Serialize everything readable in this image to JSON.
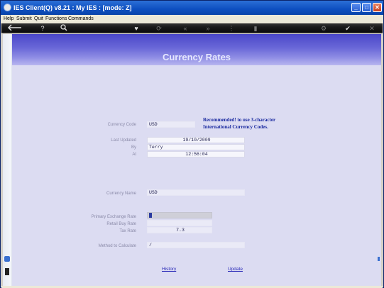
{
  "window": {
    "title": "IES Client(Q) v8.21 : My IES :       [mode: Z]",
    "minimize": "_",
    "maximize": "□",
    "close": "✕"
  },
  "menu": [
    "Help",
    "Submit",
    "Quit",
    "Functions",
    "Commands"
  ],
  "toolbar": {
    "back_icon": "arrow-left-icon",
    "help": "?",
    "search": "🔍",
    "heart": "♥",
    "refresh": "⟳",
    "prev": "«",
    "next": "»",
    "options": "⋮",
    "record": "▮",
    "settings": "⚙",
    "check": "✔",
    "close": "✕"
  },
  "page": {
    "title": "Currency Rates"
  },
  "form": {
    "currency_code_label": "Currency Code",
    "currency_code": "USD",
    "recommendation_line1": "Recommended! to use 3-character",
    "recommendation_line2": "International Currency Codes.",
    "last_updated_label": "Last Updated",
    "last_updated": "19/10/2009",
    "by_label": "By",
    "by": "Terry",
    "at_label": "At",
    "at": "12:56:04",
    "currency_name_label": "Currency Name",
    "currency_name": "USD",
    "primary_rate_label": "Primary Exchange Rate",
    "primary_rate": "",
    "retail_buy_label": "Retail Buy Rate",
    "retail_buy": "",
    "tax_rate_label": "Tax Rate",
    "tax_rate": "7.3",
    "method_label": "Method to Calculate",
    "method": "/"
  },
  "links": {
    "history": "History",
    "update": "Update"
  }
}
